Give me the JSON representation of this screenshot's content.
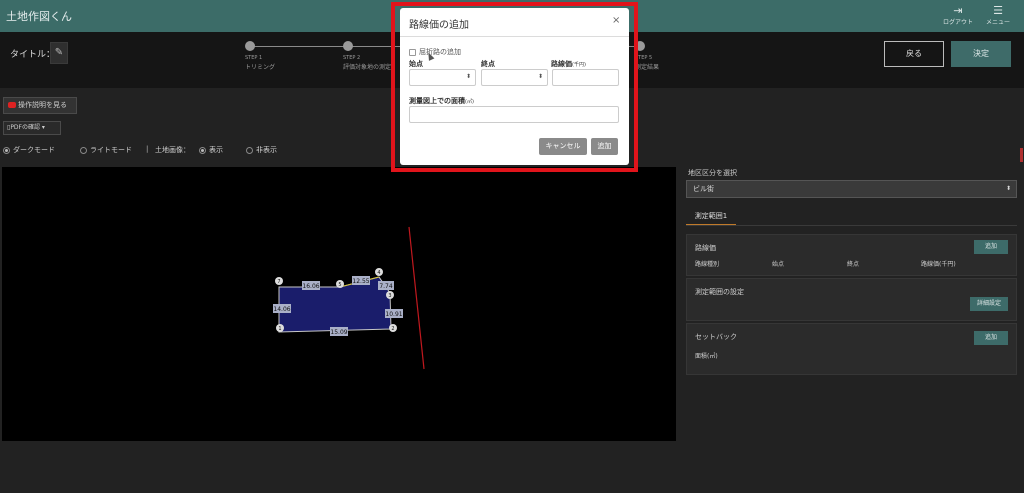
{
  "app": {
    "title": "土地作図くん"
  },
  "header": {
    "logout_label": "ログアウト",
    "menu_label": "メニュー"
  },
  "stepbar": {
    "title_label": "タイトル：",
    "steps": [
      {
        "num": "STEP 1",
        "label": "トリミング"
      },
      {
        "num": "STEP 2",
        "label": "評価対象地の測定"
      },
      {
        "num": "STEP 5",
        "label": "測定結果"
      }
    ],
    "back_label": "戻る",
    "confirm_label": "決定"
  },
  "toolbar": {
    "video_label": "操作説明を見る",
    "pdf_label": "PDFの確認"
  },
  "display": {
    "dark_mode": "ダークモード",
    "light_mode": "ライトモード",
    "separator": "|",
    "land_image_label": "土地画像：",
    "show": "表示",
    "hide": "非表示",
    "mode_selected": "dark",
    "image_selected": "show"
  },
  "drawing": {
    "edge_labels": [
      "16.06",
      "12.55",
      "7.74",
      "10.91",
      "15.09",
      "14.06"
    ],
    "vertex_numbers": [
      "1",
      "2",
      "3",
      "4",
      "5",
      "6",
      "7"
    ],
    "polygon_fill": "#1a1d6b",
    "line_color": "#c8c8c8",
    "red_line_color": "#c0181e"
  },
  "sidebar": {
    "area_label": "地区区分を選択",
    "area_value": "ビル街",
    "tab_label": "測定範囲1",
    "road_panel": {
      "title": "路線価",
      "add_label": "追加",
      "columns": [
        "路線種別",
        "始点",
        "終点",
        "路線価(千円)"
      ]
    },
    "range_panel": {
      "title": "測定範囲の設定",
      "detail_label": "詳細設定"
    },
    "setback_panel": {
      "title": "セットバック",
      "add_label": "追加",
      "area_label": "面積(㎡)"
    }
  },
  "modal": {
    "title": "路線価の追加",
    "close_label": "×",
    "checkbox_label": "屈折路の追加",
    "start_label": "始点",
    "end_label": "終点",
    "price_label": "路線価",
    "price_unit": "(千円)",
    "area_label": "測量図上での面積",
    "area_unit": "(㎡)",
    "cancel_label": "キャンセル",
    "add_label": "追加",
    "highlight_color": "#e1141b"
  }
}
